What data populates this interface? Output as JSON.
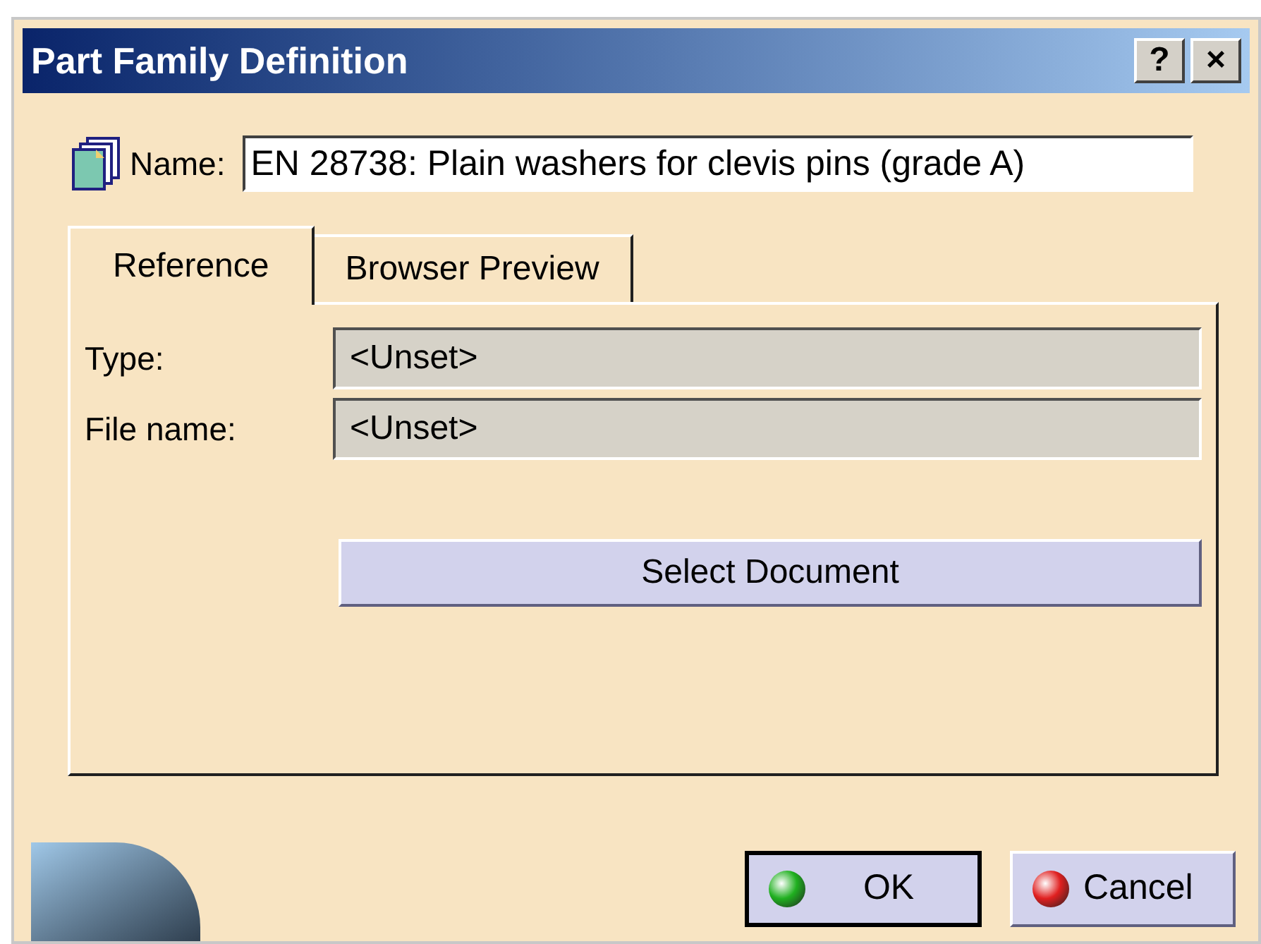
{
  "window": {
    "title": "Part Family Definition",
    "title_buttons": [
      "?",
      "×"
    ]
  },
  "name_field": {
    "label": "Name:",
    "value": "EN 28738: Plain washers for clevis pins (grade A)"
  },
  "tabs": [
    {
      "label": "Reference",
      "selected": true
    },
    {
      "label": "Browser Preview",
      "selected": false
    }
  ],
  "fields": [
    {
      "label": "Type:",
      "value": "<Unset>",
      "disabled": true
    },
    {
      "label": "File name:",
      "value": "<Unset>",
      "disabled": true
    }
  ],
  "select_button": {
    "label": "Select Document"
  },
  "buttons": [
    {
      "label": "OK",
      "kind": "ok",
      "default": true
    },
    {
      "label": "Cancel",
      "kind": "cancel",
      "default": false
    }
  ]
}
